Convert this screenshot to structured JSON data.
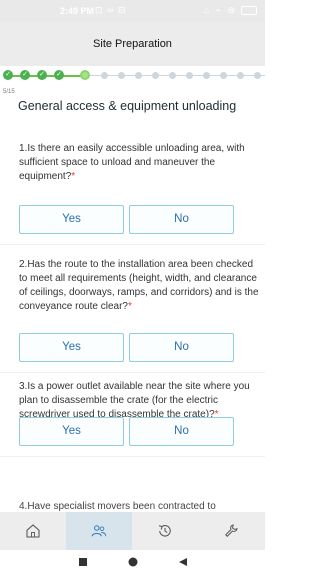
{
  "status_bar": {
    "time": "2:49 PM",
    "notifications": "⊡ ∞ ⊟",
    "right_icons": "⌂ ⌁ ⊜"
  },
  "header": {
    "title": "Site Preparation"
  },
  "progress": {
    "completed": 4,
    "current": 5,
    "total": 15,
    "step_label": "5/15",
    "done_color": "#4caf50",
    "current_color": "#a7e08e",
    "todo_color": "#cdd6dc"
  },
  "section": {
    "title": "General access & equipment unloading"
  },
  "questions": [
    {
      "text": "1.Is there an easily accessible unloading area, with sufficient space to unload and maneuver the equipment?",
      "required_mark": "*",
      "yes_label": "Yes",
      "no_label": "No"
    },
    {
      "text": "2.Has the route to the installation area been checked to meet all requirements (height, width, and clearance of ceilings, doorways, ramps, and corridors) and is the conveyance route clear?",
      "required_mark": "*",
      "yes_label": "Yes",
      "no_label": "No"
    },
    {
      "text": "3.Is a power outlet available near the site where you plan to disassemble the crate (for the electric screwdriver used to disassemble the crate)?",
      "required_mark": "*",
      "yes_label": "Yes",
      "no_label": "No"
    },
    {
      "text": "4.Have specialist movers been contracted to"
    }
  ],
  "bottom_nav": {
    "items": [
      {
        "icon": "home-icon"
      },
      {
        "icon": "people-icon",
        "active": true
      },
      {
        "icon": "history-icon"
      },
      {
        "icon": "wrench-icon"
      }
    ]
  },
  "accent_color": "#2c6fb0"
}
